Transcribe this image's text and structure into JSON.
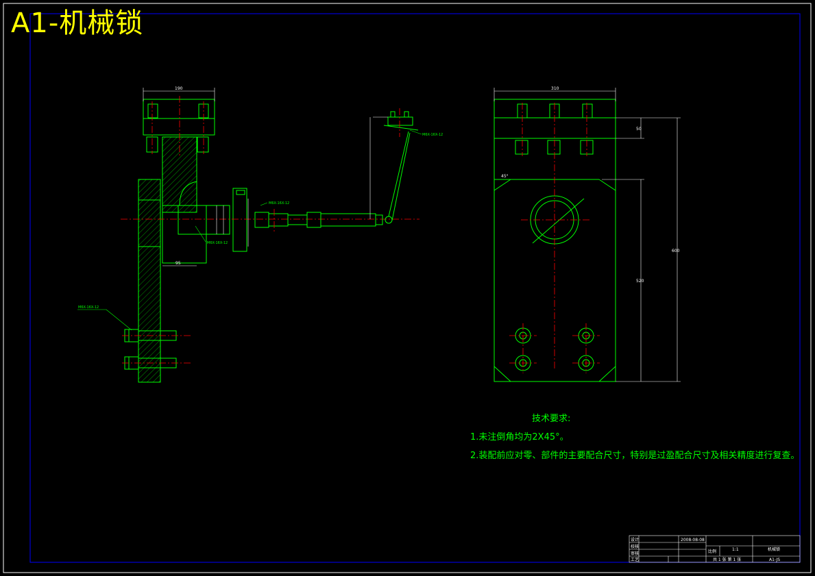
{
  "drawing_title": "A1-机械锁",
  "notes": {
    "heading": "技术要求:",
    "items": [
      "1.未注倒角均为2X45°。",
      "2.装配前应对零、部件的主要配合尺寸，特别是过盈配合尺寸及相关精度进行复查。"
    ]
  },
  "dimensions": {
    "left_top_width": "190",
    "left_bottom": "95",
    "right_top_width": "310",
    "right_flange": "50",
    "right_height": "600",
    "right_inner": "520",
    "chamfer": "45°"
  },
  "labels": {
    "left_screw": "M6X-16X-12",
    "cyl_label_1": "M6X-16X-12",
    "cyl_label_2": "M6X-16X-12",
    "right_arm": "M6X-16X-12"
  },
  "title_block": {
    "rows": [
      "设计",
      "校核",
      "审核",
      "工艺"
    ],
    "date": "2008-08-08",
    "scale_label": "比例",
    "scale": "1:1",
    "name": "机械锁",
    "sheet": "共 1 张 第 1 张",
    "code": "A1-JS"
  },
  "colors": {
    "frame": "#0000ff",
    "outline": "#00ff00",
    "centerline": "#ff0000",
    "dimension": "#ffffff",
    "title": "#ffff00"
  }
}
